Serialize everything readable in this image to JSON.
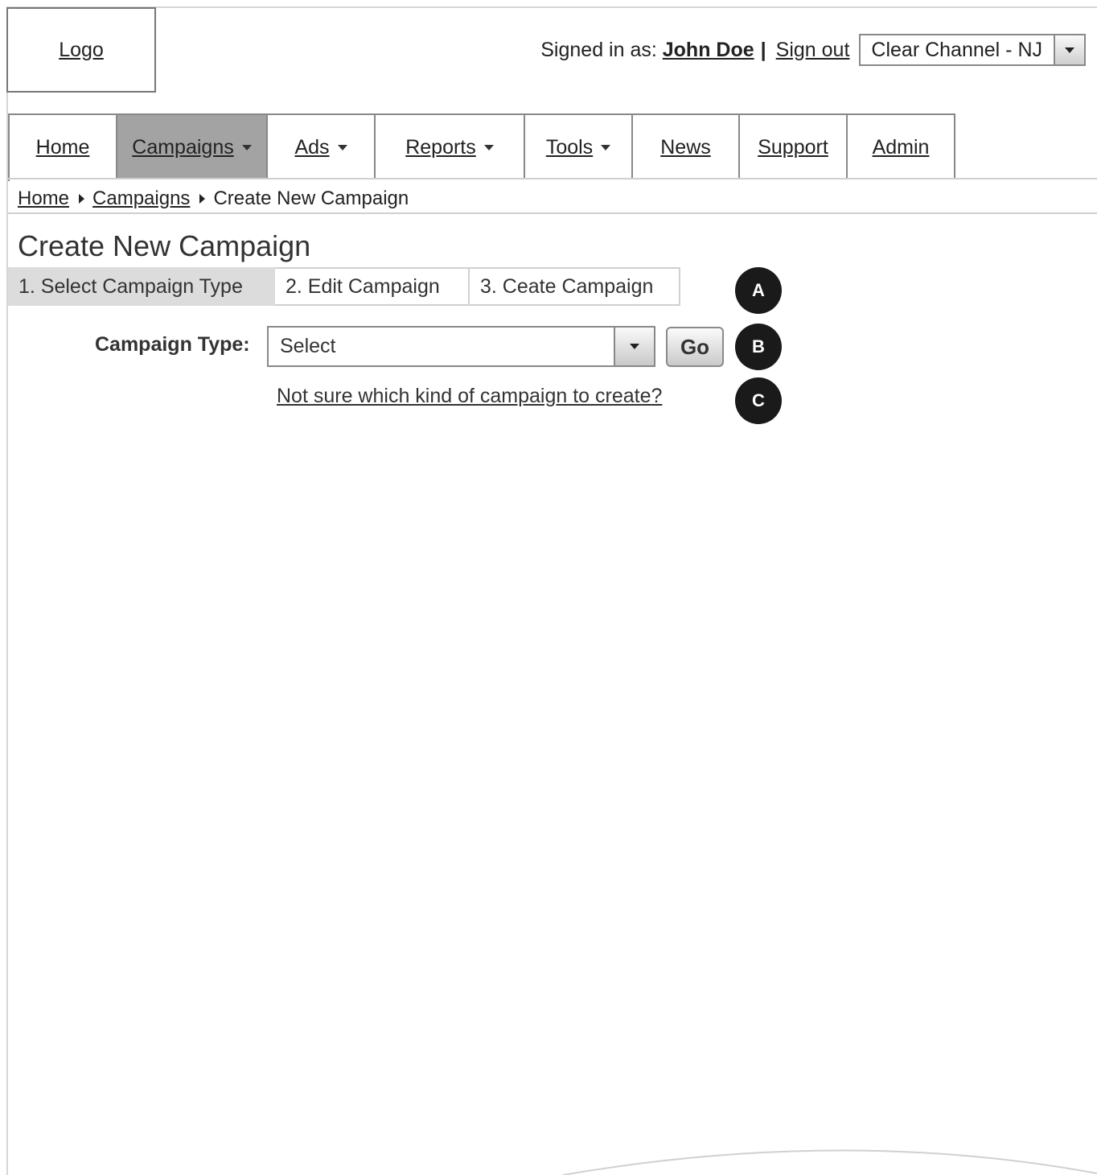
{
  "header": {
    "logo_label": "Logo",
    "signed_in_prefix": "Signed in as:",
    "username": "John Doe",
    "separator": "|",
    "sign_out_label": "Sign out",
    "organization": "Clear Channel - NJ"
  },
  "nav": {
    "tabs": [
      {
        "label": "Home",
        "has_dropdown": false,
        "active": false
      },
      {
        "label": "Campaigns",
        "has_dropdown": true,
        "active": true
      },
      {
        "label": "Ads",
        "has_dropdown": true,
        "active": false
      },
      {
        "label": "Reports",
        "has_dropdown": true,
        "active": false
      },
      {
        "label": "Tools",
        "has_dropdown": true,
        "active": false
      },
      {
        "label": "News",
        "has_dropdown": false,
        "active": false
      },
      {
        "label": "Support",
        "has_dropdown": false,
        "active": false
      },
      {
        "label": "Admin",
        "has_dropdown": false,
        "active": false
      }
    ]
  },
  "breadcrumb": {
    "items": [
      "Home",
      "Campaigns"
    ],
    "current": "Create New Campaign"
  },
  "page": {
    "title": "Create New Campaign"
  },
  "steps": [
    {
      "label": "1. Select Campaign Type",
      "active": true
    },
    {
      "label": "2. Edit Campaign",
      "active": false
    },
    {
      "label": "3. Ceate Campaign",
      "active": false
    }
  ],
  "form": {
    "campaign_type_label": "Campaign Type:",
    "campaign_type_value": "Select",
    "go_label": "Go",
    "help_link": "Not sure which kind of campaign to create?"
  },
  "annotations": {
    "a": "A",
    "b": "B",
    "c": "C"
  },
  "colors": {
    "active_nav": "#a3a3a3",
    "active_step": "#dcdcdc",
    "badge": "#1a1a1a",
    "border": "#888888"
  }
}
